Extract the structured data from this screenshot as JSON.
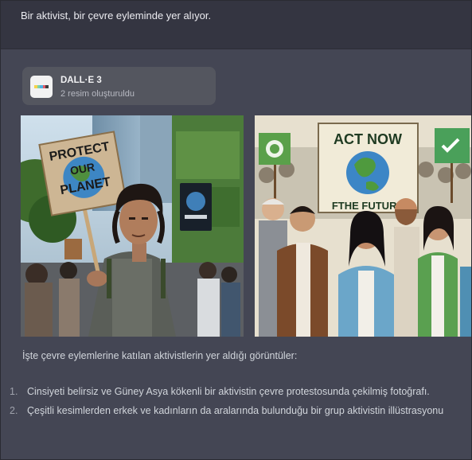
{
  "user_message": "Bir aktivist, bir çevre eyleminde yer alıyor.",
  "dalle_card": {
    "title": "DALL·E 3",
    "subtitle": "2 resim oluşturuldu",
    "logo_colors": [
      "#f6d44a",
      "#7dd3a8",
      "#4fb3e0",
      "#e25a6a",
      "#3d3d3d"
    ]
  },
  "images": [
    {
      "kind": "photo",
      "sign_lines": [
        "PROTECT",
        "OUR",
        "PLANET"
      ]
    },
    {
      "kind": "illustration",
      "sign_line1": "ACT NOW",
      "sign_line2": "FTHE FUTURE"
    }
  ],
  "assistant": {
    "description": "İşte çevre eylemlerine katılan aktivistlerin yer aldığı görüntüler:",
    "items": [
      {
        "num": "1.",
        "text": "Cinsiyeti belirsiz ve Güney Asya kökenli bir aktivistin çevre protestosunda çekilmiş fotoğrafı."
      },
      {
        "num": "2.",
        "text": "Çeşitli kesimlerden erkek ve kadınların da aralarında bulunduğu bir grup aktivistin illüstrasyonu"
      }
    ]
  }
}
